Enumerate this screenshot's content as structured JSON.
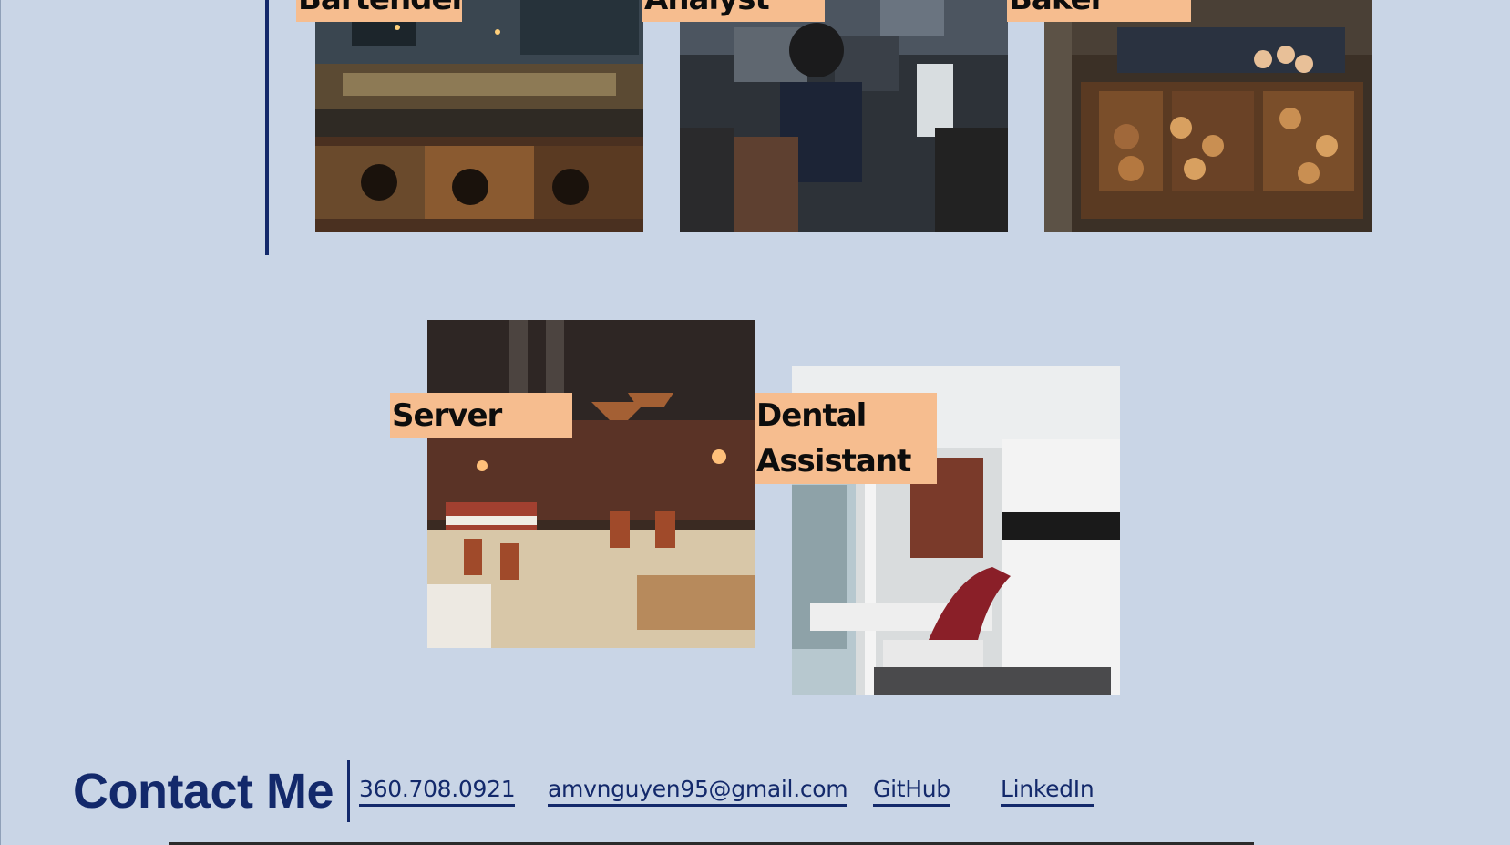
{
  "jobs_top": [
    {
      "label": "Bartender"
    },
    {
      "label": "Analyst"
    },
    {
      "label": "Baker"
    }
  ],
  "jobs_bottom": [
    {
      "label": "Server"
    },
    {
      "label": "Dental Assistant"
    }
  ],
  "contact": {
    "title": "Contact Me",
    "phone": "360.708.0921",
    "email": "amvnguyen95@gmail.com",
    "github": "GitHub",
    "linkedin": "LinkedIn"
  },
  "colors": {
    "background": "#c9d5e6",
    "accent": "#13296b",
    "label_bg": "#f6bd8f"
  }
}
